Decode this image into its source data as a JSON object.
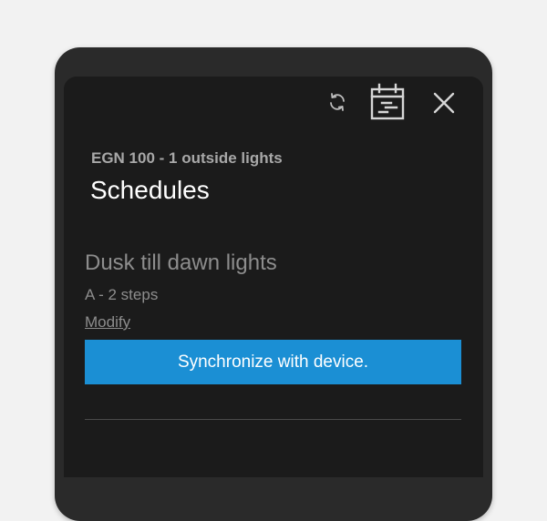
{
  "header": {
    "icons": {
      "sync": "sync-icon",
      "calendar": "calendar-schedule-icon",
      "close": "close-icon"
    }
  },
  "device": {
    "subtitle": "EGN 100 - 1 outside lights"
  },
  "page": {
    "title": "Schedules"
  },
  "schedule": {
    "name": "Dusk till dawn lights",
    "meta": "A  -  2 steps",
    "modify_label": "Modify"
  },
  "actions": {
    "sync_label": "Synchronize with device."
  },
  "colors": {
    "accent": "#1b8fd4",
    "background": "#1b1b1b",
    "bezel": "#2a2a2a"
  }
}
